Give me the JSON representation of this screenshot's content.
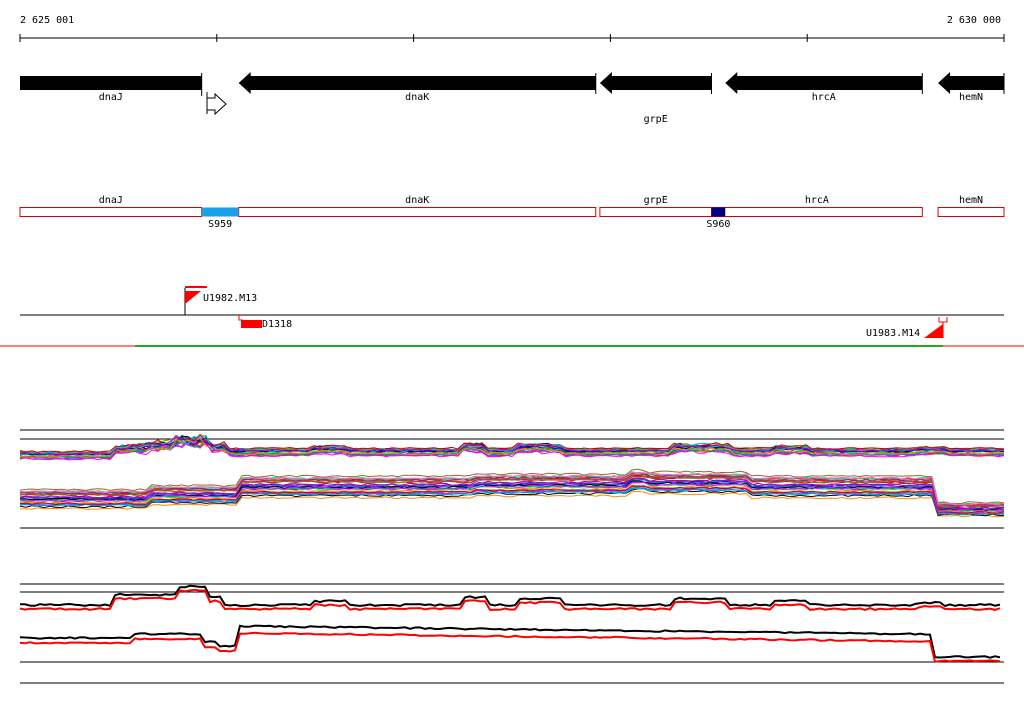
{
  "ruler": {
    "start_label": "2 625 001",
    "end_label": "2 630 000"
  },
  "genes": [
    {
      "name": "dnaJ",
      "strand": "+",
      "start": 2625001,
      "end": 2625924
    },
    {
      "name": "dnaK",
      "strand": "-",
      "start": 2626112,
      "end": 2627926
    },
    {
      "name": "grpE",
      "strand": "-",
      "start": 2627947,
      "end": 2628514
    },
    {
      "name": "hrcA",
      "strand": "-",
      "start": 2628584,
      "end": 2629585
    },
    {
      "name": "hemN",
      "strand": "-",
      "start": 2629665,
      "end": 2630000
    }
  ],
  "transcripts": [
    {
      "name": "dnaJ",
      "start": 2625001,
      "end": 2625924
    },
    {
      "name": "dnaK",
      "start": 2626112,
      "end": 2627926
    },
    {
      "name": "grpE",
      "start": 2627947,
      "end": 2628514
    },
    {
      "name": "hrcA",
      "start": 2628514,
      "end": 2629585
    },
    {
      "name": "hemN",
      "start": 2629665,
      "end": 2630000
    }
  ],
  "segments": [
    {
      "label": "S959",
      "start": 2625924,
      "end": 2626112,
      "color": "#1a9fe8"
    },
    {
      "label": "S960",
      "start": 2628514,
      "end": 2628584,
      "color": "#000080"
    }
  ],
  "features": {
    "u1982": "U1982.M13",
    "u1983": "U1983.M14",
    "d1318": "D1318"
  },
  "colors": {
    "gene": "#000000",
    "transcript_border": "#dd0000",
    "feature_red": "#ff0000",
    "green_line": "#22aa22"
  }
}
